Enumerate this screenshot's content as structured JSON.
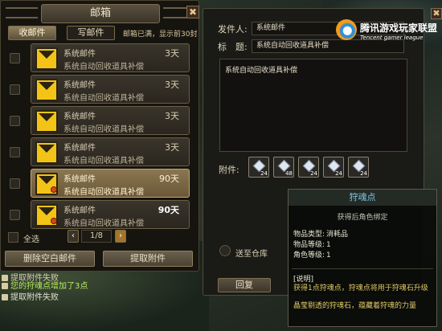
{
  "mailbox": {
    "title": "邮箱",
    "close_glyph": "✖",
    "tabs": [
      {
        "label": "收邮件",
        "active": true
      },
      {
        "label": "写邮件",
        "active": false
      }
    ],
    "notice": "邮箱已满，显示前30封",
    "mails": [
      {
        "sender": "系统邮件",
        "subject": "系统自动回收道具补偿",
        "days": "3天",
        "selected": false
      },
      {
        "sender": "系统邮件",
        "subject": "系统自动回收道具补偿",
        "days": "3天",
        "selected": false
      },
      {
        "sender": "系统邮件",
        "subject": "系统自动回收道具补偿",
        "days": "3天",
        "selected": false
      },
      {
        "sender": "系统邮件",
        "subject": "系统自动回收道具补偿",
        "days": "3天",
        "selected": false
      },
      {
        "sender": "系统邮件",
        "subject": "系统自动回收道具补偿",
        "days": "90天",
        "selected": true
      },
      {
        "sender": "系统邮件",
        "subject": "系统自动回收道具补偿",
        "days": "90天",
        "selected": false
      }
    ],
    "select_all_label": "全选",
    "page": "1/8",
    "prev_glyph": "‹",
    "next_glyph": "›",
    "delete_empty_label": "删除空白邮件",
    "take_attachments_label": "提取附件"
  },
  "chat": [
    {
      "text": "提取附件失败",
      "color": "#d9d0b0"
    },
    {
      "text": "您的狩魂点增加了3点",
      "color": "#b6ec5f"
    },
    {
      "text": "提取附件失败",
      "color": "#e5e1cf"
    }
  ],
  "detail": {
    "sender_label": "发件人:",
    "sender_value": "系统邮件",
    "subject_label": "标　题:",
    "subject_value": "系统自动回收道具补偿",
    "body": "系统自动回收道具补偿",
    "attachments_label": "附件:",
    "attachments": [
      {
        "icon": "soul-gem-icon",
        "qty": "24"
      },
      {
        "icon": "soul-gem-icon",
        "qty": "48"
      },
      {
        "icon": "soul-gem-icon",
        "qty": "24"
      },
      {
        "icon": "soul-gem-icon",
        "qty": "24"
      },
      {
        "icon": "soul-gem-icon",
        "qty": "24"
      }
    ],
    "send_to_trash_label": "送至仓库",
    "reply_label": "回复",
    "close_glyph": "✖"
  },
  "tooltip": {
    "name": "狩魂点",
    "binding": "获得后角色绑定",
    "type_label": "物品类型:",
    "type_value": "消耗品",
    "item_level_label": "物品等级:",
    "item_level_value": "1",
    "char_level_label": "角色等级:",
    "char_level_value": "1",
    "desc_header": "[说明]",
    "desc_line1": "获得1点狩魂点，狩魂点将用于狩魂石升级",
    "desc_line2": "晶莹剔透的狩魂石，蕴藏着狩魂的力量"
  },
  "watermark": {
    "cn": "腾讯游戏玩家联盟",
    "en": "Tencent gamer league"
  },
  "colors": {
    "panel_border": "#4a4232",
    "selected_mail": "#8a7650",
    "envelope": "#f3c417",
    "tooltip_title": "#7fc6e8",
    "tooltip_desc": "#e0c865",
    "chat_gain": "#b6ec5f"
  }
}
